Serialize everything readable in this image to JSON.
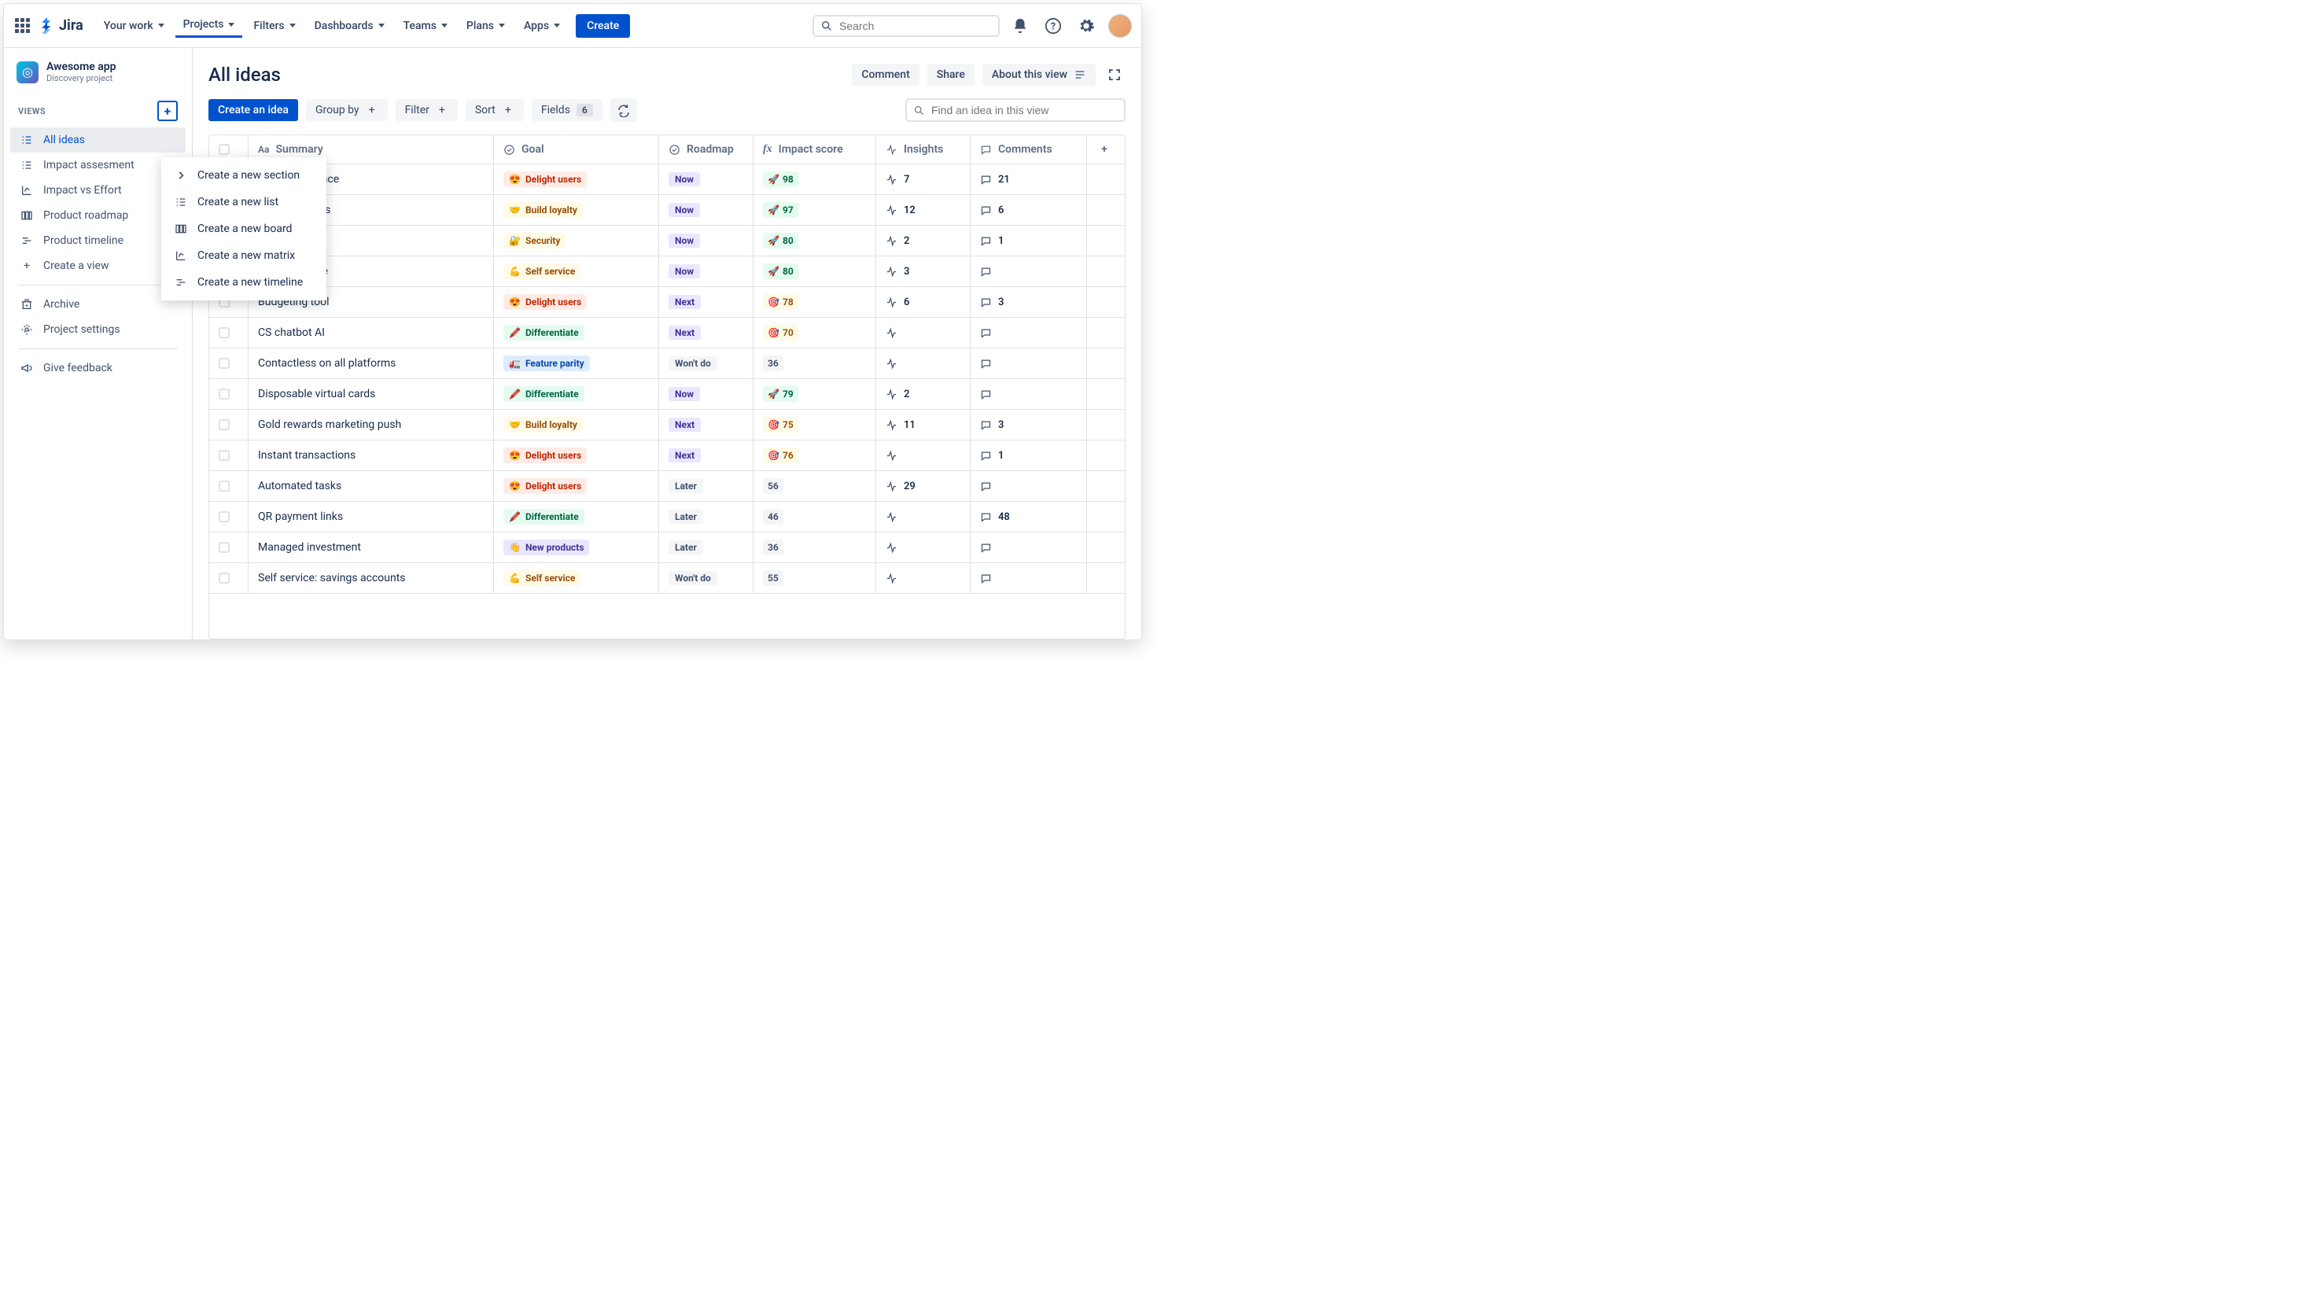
{
  "topbar": {
    "brand": "Jira",
    "nav": [
      "Your work",
      "Projects",
      "Filters",
      "Dashboards",
      "Teams",
      "Plans",
      "Apps"
    ],
    "active_nav_index": 1,
    "create": "Create",
    "search_placeholder": "Search"
  },
  "sidebar": {
    "project": {
      "name": "Awesome app",
      "subtitle": "Discovery project"
    },
    "views_header": "VIEWS",
    "views": [
      {
        "label": "All ideas",
        "icon": "list",
        "active": true
      },
      {
        "label": "Impact assesment",
        "icon": "list",
        "active": false
      },
      {
        "label": "Impact vs Effort",
        "icon": "matrix",
        "active": false
      },
      {
        "label": "Product roadmap",
        "icon": "board",
        "active": false
      },
      {
        "label": "Product timeline",
        "icon": "timeline",
        "active": false
      }
    ],
    "create_view": "Create a view",
    "archive": "Archive",
    "settings": "Project settings",
    "feedback": "Give feedback"
  },
  "dropdown": {
    "items": [
      {
        "label": "Create a new section",
        "icon": "chevron"
      },
      {
        "label": "Create a new list",
        "icon": "list"
      },
      {
        "label": "Create a new board",
        "icon": "board"
      },
      {
        "label": "Create a new matrix",
        "icon": "matrix"
      },
      {
        "label": "Create a new timeline",
        "icon": "timeline"
      }
    ]
  },
  "main": {
    "title": "All ideas",
    "head_actions": {
      "comment": "Comment",
      "share": "Share",
      "about": "About this view"
    },
    "toolbar": {
      "create_idea": "Create an idea",
      "group_by": "Group by",
      "filter": "Filter",
      "sort": "Sort",
      "fields": "Fields",
      "fields_count": "6",
      "find_placeholder": "Find an idea in this view"
    },
    "columns": {
      "summary": "Summary",
      "goal": "Goal",
      "roadmap": "Roadmap",
      "impact": "Impact score",
      "insights": "Insights",
      "comments": "Comments"
    },
    "goal_styles": {
      "Delight users": {
        "emoji": "😍",
        "bg": "#FFEBE6",
        "fg": "#BF2600"
      },
      "Build loyalty": {
        "emoji": "🤝",
        "bg": "#FFFAE6",
        "fg": "#974F0C"
      },
      "Security": {
        "emoji": "🔐",
        "bg": "#FFFAE6",
        "fg": "#974F0C"
      },
      "Self service": {
        "emoji": "💪",
        "bg": "#FFFAE6",
        "fg": "#974F0C"
      },
      "Differentiate": {
        "emoji": "🖍️",
        "bg": "#E3FCEF",
        "fg": "#006644"
      },
      "Feature parity": {
        "emoji": "🚛",
        "bg": "#DEEBFF",
        "fg": "#0747A6"
      },
      "New products": {
        "emoji": "👋",
        "bg": "#EAE6FF",
        "fg": "#403294"
      }
    },
    "roadmap_styles": {
      "Now": {
        "bg": "#EAE6FF",
        "fg": "#403294"
      },
      "Next": {
        "bg": "#EAE6FF",
        "fg": "#403294"
      },
      "Later": {
        "bg": "#F4F5F7",
        "fg": "#42526E"
      },
      "Won't do": {
        "bg": "#F4F5F7",
        "fg": "#42526E"
      }
    },
    "rows": [
      {
        "summary": "user interface",
        "partial": true,
        "goal": "Delight users",
        "roadmap": "Now",
        "impact": 98,
        "impact_tier": "rocket",
        "insights": 7,
        "comments": 21
      },
      {
        "summary": "experiences",
        "partial": true,
        "goal": "Build loyalty",
        "roadmap": "Now",
        "impact": 97,
        "impact_tier": "rocket",
        "insights": 12,
        "comments": 6
      },
      {
        "summary": "",
        "partial": true,
        "goal": "Security",
        "roadmap": "Now",
        "impact": 80,
        "impact_tier": "rocket",
        "insights": 2,
        "comments": 1
      },
      {
        "summary": "e insurance",
        "partial": true,
        "goal": "Self service",
        "roadmap": "Now",
        "impact": 80,
        "impact_tier": "rocket",
        "insights": 3,
        "comments": null
      },
      {
        "summary": "Budgeting tool",
        "goal": "Delight users",
        "roadmap": "Next",
        "impact": 78,
        "impact_tier": "target",
        "insights": 6,
        "comments": 3
      },
      {
        "summary": "CS chatbot AI",
        "goal": "Differentiate",
        "roadmap": "Next",
        "impact": 70,
        "impact_tier": "target",
        "insights": null,
        "comments": null
      },
      {
        "summary": "Contactless on all platforms",
        "goal": "Feature parity",
        "roadmap": "Won't do",
        "impact": 36,
        "impact_tier": "none",
        "insights": null,
        "comments": null
      },
      {
        "summary": "Disposable virtual cards",
        "goal": "Differentiate",
        "roadmap": "Now",
        "impact": 79,
        "impact_tier": "rocket",
        "insights": 2,
        "comments": null
      },
      {
        "summary": "Gold rewards marketing push",
        "goal": "Build loyalty",
        "roadmap": "Next",
        "impact": 75,
        "impact_tier": "target",
        "insights": 11,
        "comments": 3
      },
      {
        "summary": "Instant transactions",
        "goal": "Delight users",
        "roadmap": "Next",
        "impact": 76,
        "impact_tier": "target",
        "insights": null,
        "comments": 1
      },
      {
        "summary": "Automated tasks",
        "goal": "Delight users",
        "roadmap": "Later",
        "impact": 56,
        "impact_tier": "none",
        "insights": 29,
        "comments": null
      },
      {
        "summary": "QR payment links",
        "goal": "Differentiate",
        "roadmap": "Later",
        "impact": 46,
        "impact_tier": "none",
        "insights": null,
        "comments": 48
      },
      {
        "summary": "Managed investment",
        "goal": "New products",
        "roadmap": "Later",
        "impact": 36,
        "impact_tier": "none",
        "insights": null,
        "comments": null
      },
      {
        "summary": "Self service: savings accounts",
        "goal": "Self service",
        "roadmap": "Won't do",
        "impact": 55,
        "impact_tier": "none",
        "insights": null,
        "comments": null
      }
    ]
  }
}
